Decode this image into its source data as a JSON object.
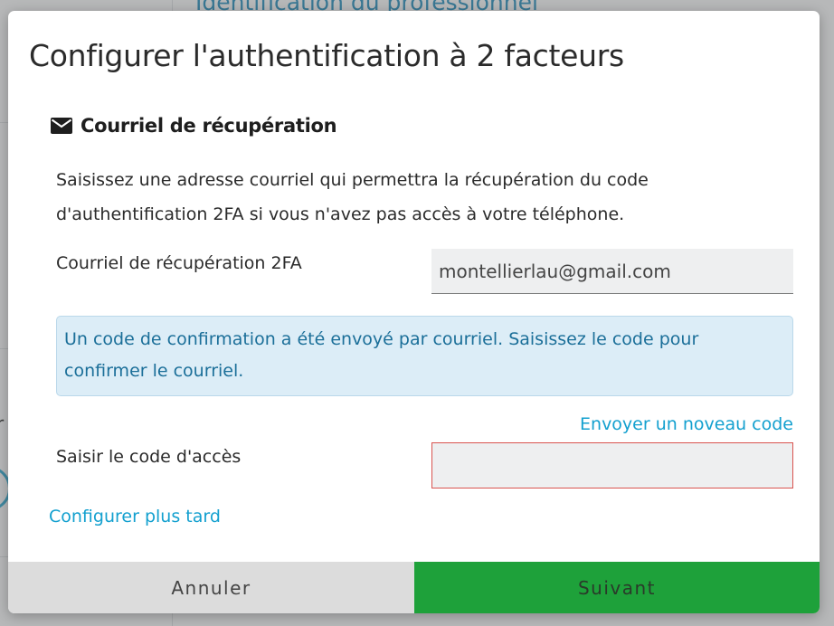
{
  "background": {
    "heading": "Identification du professionnel",
    "stray_text": "r"
  },
  "modal": {
    "title": "Configurer l'authentification à 2 facteurs",
    "section": {
      "icon": "envelope-icon",
      "title": "Courriel de récupération"
    },
    "description": "Saisissez une adresse courriel qui permettra la récupération du code d'authentification 2FA si vous n'avez pas accès à votre téléphone.",
    "recovery_email": {
      "label": "Courriel de récupération 2FA",
      "value": "montellierlau@gmail.com"
    },
    "info_message": "Un code de confirmation a été envoyé par courriel. Saisissez le code pour confirmer le courriel.",
    "resend_link": "Envoyer un noveau code",
    "access_code": {
      "label": "Saisir le code d'accès",
      "value": ""
    },
    "configure_later_link": "Configurer plus tard",
    "buttons": {
      "cancel": "Annuler",
      "next": "Suivant"
    }
  },
  "colors": {
    "accent_link": "#13a0cf",
    "primary_button": "#1ea13a",
    "info_background": "#dcedf7",
    "error_border": "#d9534f"
  }
}
